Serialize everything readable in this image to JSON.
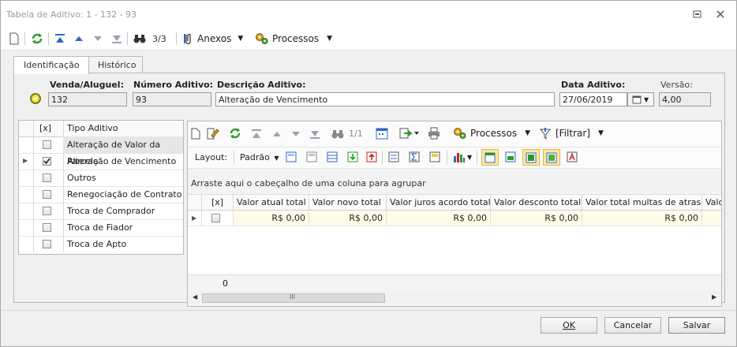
{
  "window": {
    "title": "Tabela de Aditivo: 1 - 132 - 93"
  },
  "toolbar": {
    "record_counter": "3/3",
    "anexos_label": "Anexos",
    "processos_label": "Processos"
  },
  "tabs": [
    {
      "label": "Identificação",
      "active": true
    },
    {
      "label": "Histórico",
      "active": false
    }
  ],
  "form": {
    "venda_label": "Venda/Aluguel:",
    "venda_value": "132",
    "numero_label": "Número Aditivo:",
    "numero_value": "93",
    "descricao_label": "Descrição Aditivo:",
    "descricao_value": "Alteração de Vencimento",
    "data_label": "Data Aditivo:",
    "data_value": "27/06/2019",
    "versao_label": "Versão:",
    "versao_value": "4,00"
  },
  "left_grid": {
    "col_check": "[x]",
    "col_tipo": "Tipo Aditivo",
    "rows": [
      {
        "label": "Alteração de Valor da Parcela",
        "checked": false,
        "selected": true
      },
      {
        "label": "Alteração de Vencimento",
        "checked": true,
        "current": true
      },
      {
        "label": "Outros",
        "checked": false
      },
      {
        "label": "Renegociação de Contrato",
        "checked": false
      },
      {
        "label": "Troca de Comprador",
        "checked": false
      },
      {
        "label": "Troca de Fiador",
        "checked": false
      },
      {
        "label": "Troca de Apto",
        "checked": false
      }
    ]
  },
  "right_grid": {
    "counter": "1/1",
    "processos_label": "Processos",
    "filtrar_label": "[Filtrar]",
    "layout_label": "Layout:",
    "padrao_label": "Padrão",
    "group_hint": "Arraste aqui o cabeçalho de uma coluna para agrupar",
    "col_check": "[x]",
    "columns": [
      "Valor atual total",
      "Valor novo total",
      "Valor juros acordo total",
      "Valor desconto total",
      "Valor total multas de atraso",
      "Valo"
    ],
    "row": [
      "R$ 0,00",
      "R$ 0,00",
      "R$ 0,00",
      "R$ 0,00",
      "R$ 0,00"
    ],
    "footer_count": "0",
    "scroll_mark": "III"
  },
  "buttons": {
    "ok": "OK",
    "cancelar": "Cancelar",
    "salvar": "Salvar"
  },
  "colors": {
    "highlight": "#fde7a1",
    "row_tint": "#fffbe9",
    "accent_green": "#2b9a2b",
    "accent_blue": "#2f66c9"
  }
}
